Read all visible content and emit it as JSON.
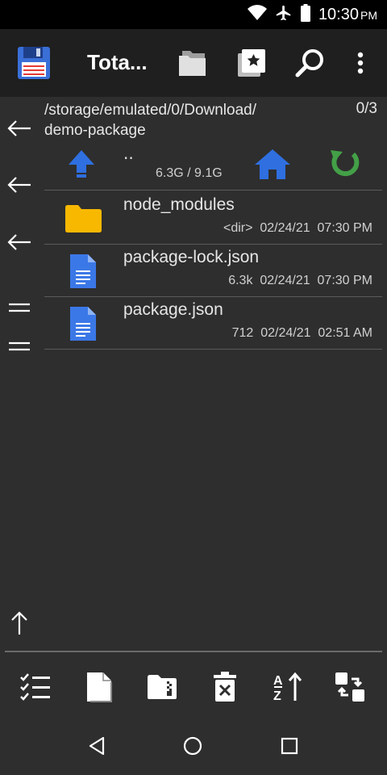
{
  "status_bar": {
    "time": "10:30",
    "ampm": "PM"
  },
  "app_bar": {
    "title": "Tota..."
  },
  "path": {
    "line1": "/storage/emulated/0/Download/",
    "line2": "demo-package",
    "count": "0/3"
  },
  "parent_row": {
    "name": "..",
    "space": "6.3G / 9.1G"
  },
  "files": [
    {
      "name": "node_modules",
      "size": "<dir>",
      "date": "02/24/21",
      "time": "07:30 PM",
      "type": "folder"
    },
    {
      "name": "package-lock.json",
      "size": "6.3k",
      "date": "02/24/21",
      "time": "07:30 PM",
      "type": "document"
    },
    {
      "name": "package.json",
      "size": "712",
      "date": "02/24/21",
      "time": "02:51 AM",
      "type": "document"
    }
  ],
  "colors": {
    "folder": "#f9b800",
    "document": "#3b78e7",
    "up_arrow": "#2f6fe0",
    "home": "#2f6fe0",
    "refresh": "#43a047"
  }
}
